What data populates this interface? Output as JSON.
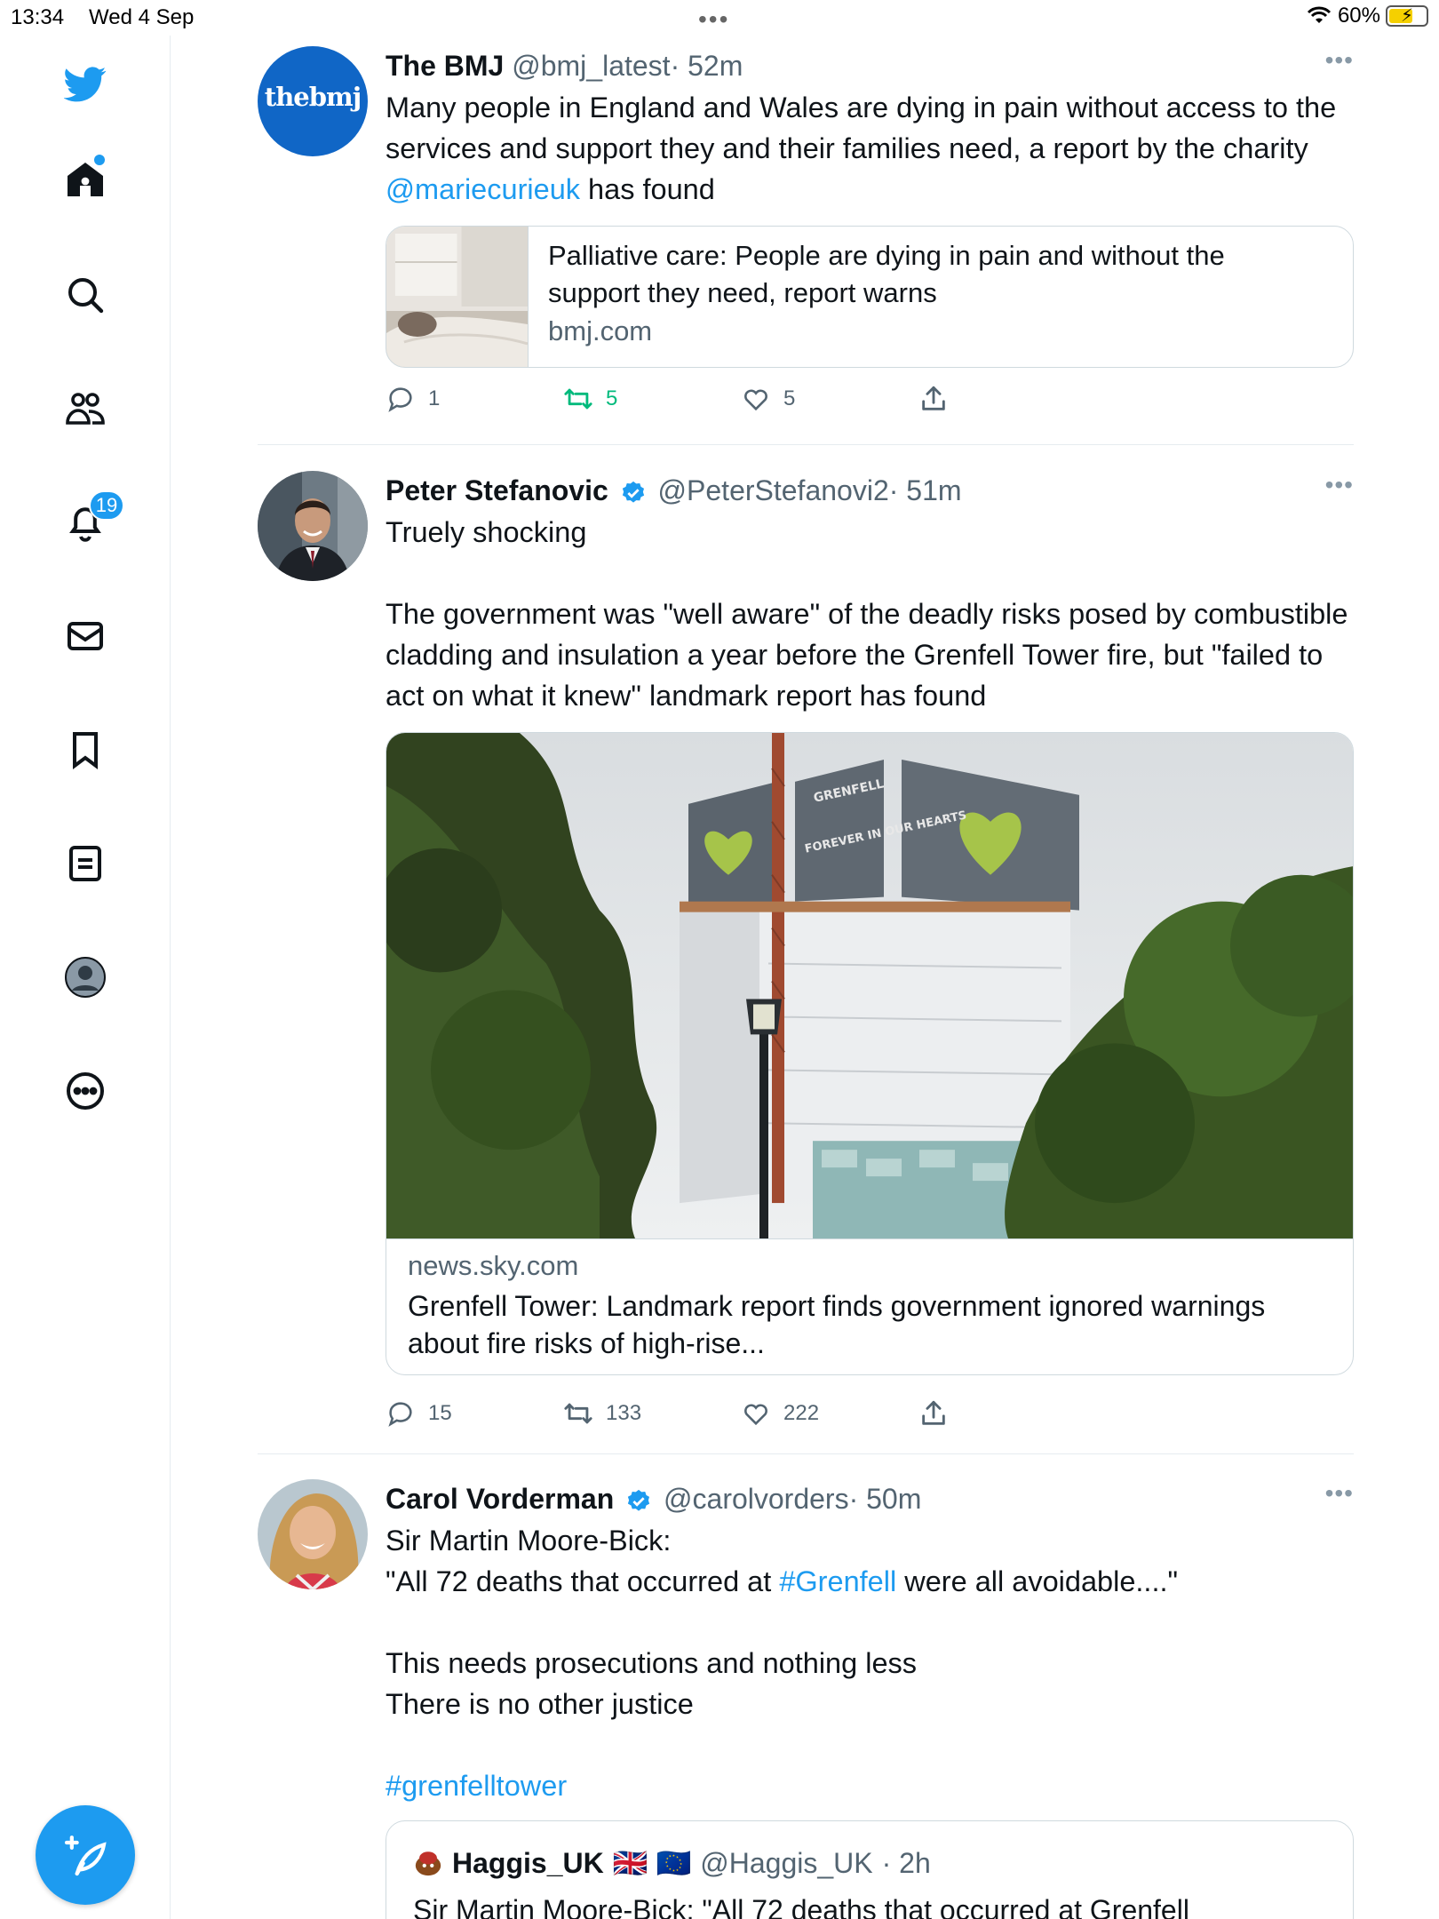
{
  "status_bar": {
    "time": "13:34",
    "date": "Wed 4 Sep",
    "battery": "60%"
  },
  "sidebar": {
    "notifications_badge": "19",
    "accent_color": "#1d9bf0"
  },
  "tweets": [
    {
      "name": "The BMJ",
      "handle": "@bmj_latest",
      "time": "· 52m",
      "avatar_text": "thebmj",
      "text_before": "Many people in England and Wales are dying in pain without access to the services and support they and their families need, a report by the charity ",
      "mention": "@mariecurieuk",
      "text_after": " has found",
      "card": {
        "title": "Palliative care: People are dying in pain and without the support they need, report warns",
        "domain": "bmj.com"
      },
      "replies": "1",
      "retweets": "5",
      "likes": "5"
    },
    {
      "name": "Peter Stefanovic",
      "handle": "@PeterStefanovi2",
      "time": "· 51m",
      "text": "Truely shocking\n\nThe government was \"well aware\" of the deadly risks posed by combustible cladding and insulation a year before the Grenfell Tower fire, but \"failed to act on what it knew\" landmark report has found",
      "card": {
        "domain": "news.sky.com",
        "title": "Grenfell Tower: Landmark report finds government ignored warnings about fire risks of high-rise...",
        "banner_top": "GRENFELL",
        "banner_bottom": "FOREVER IN OUR HEARTS"
      },
      "replies": "15",
      "retweets": "133",
      "likes": "222"
    },
    {
      "name": "Carol Vorderman",
      "handle": "@carolvorders",
      "time": "· 50m",
      "line1": "Sir Martin Moore-Bick:",
      "line2_before": "\"All 72 deaths that occurred at ",
      "line2_hashtag": "#Grenfell",
      "line2_after": " were all avoidable....\"",
      "line3": "This needs prosecutions and nothing less",
      "line4": "There is no other justice",
      "hashtag": "#grenfelltower",
      "quote": {
        "name": "Haggis_UK",
        "flags": "🇬🇧 🇪🇺",
        "handle": "@Haggis_UK",
        "time": "· 2h",
        "text": "Sir Martin Moore-Bick: \"All 72 deaths that occurred at Grenfell"
      }
    }
  ]
}
